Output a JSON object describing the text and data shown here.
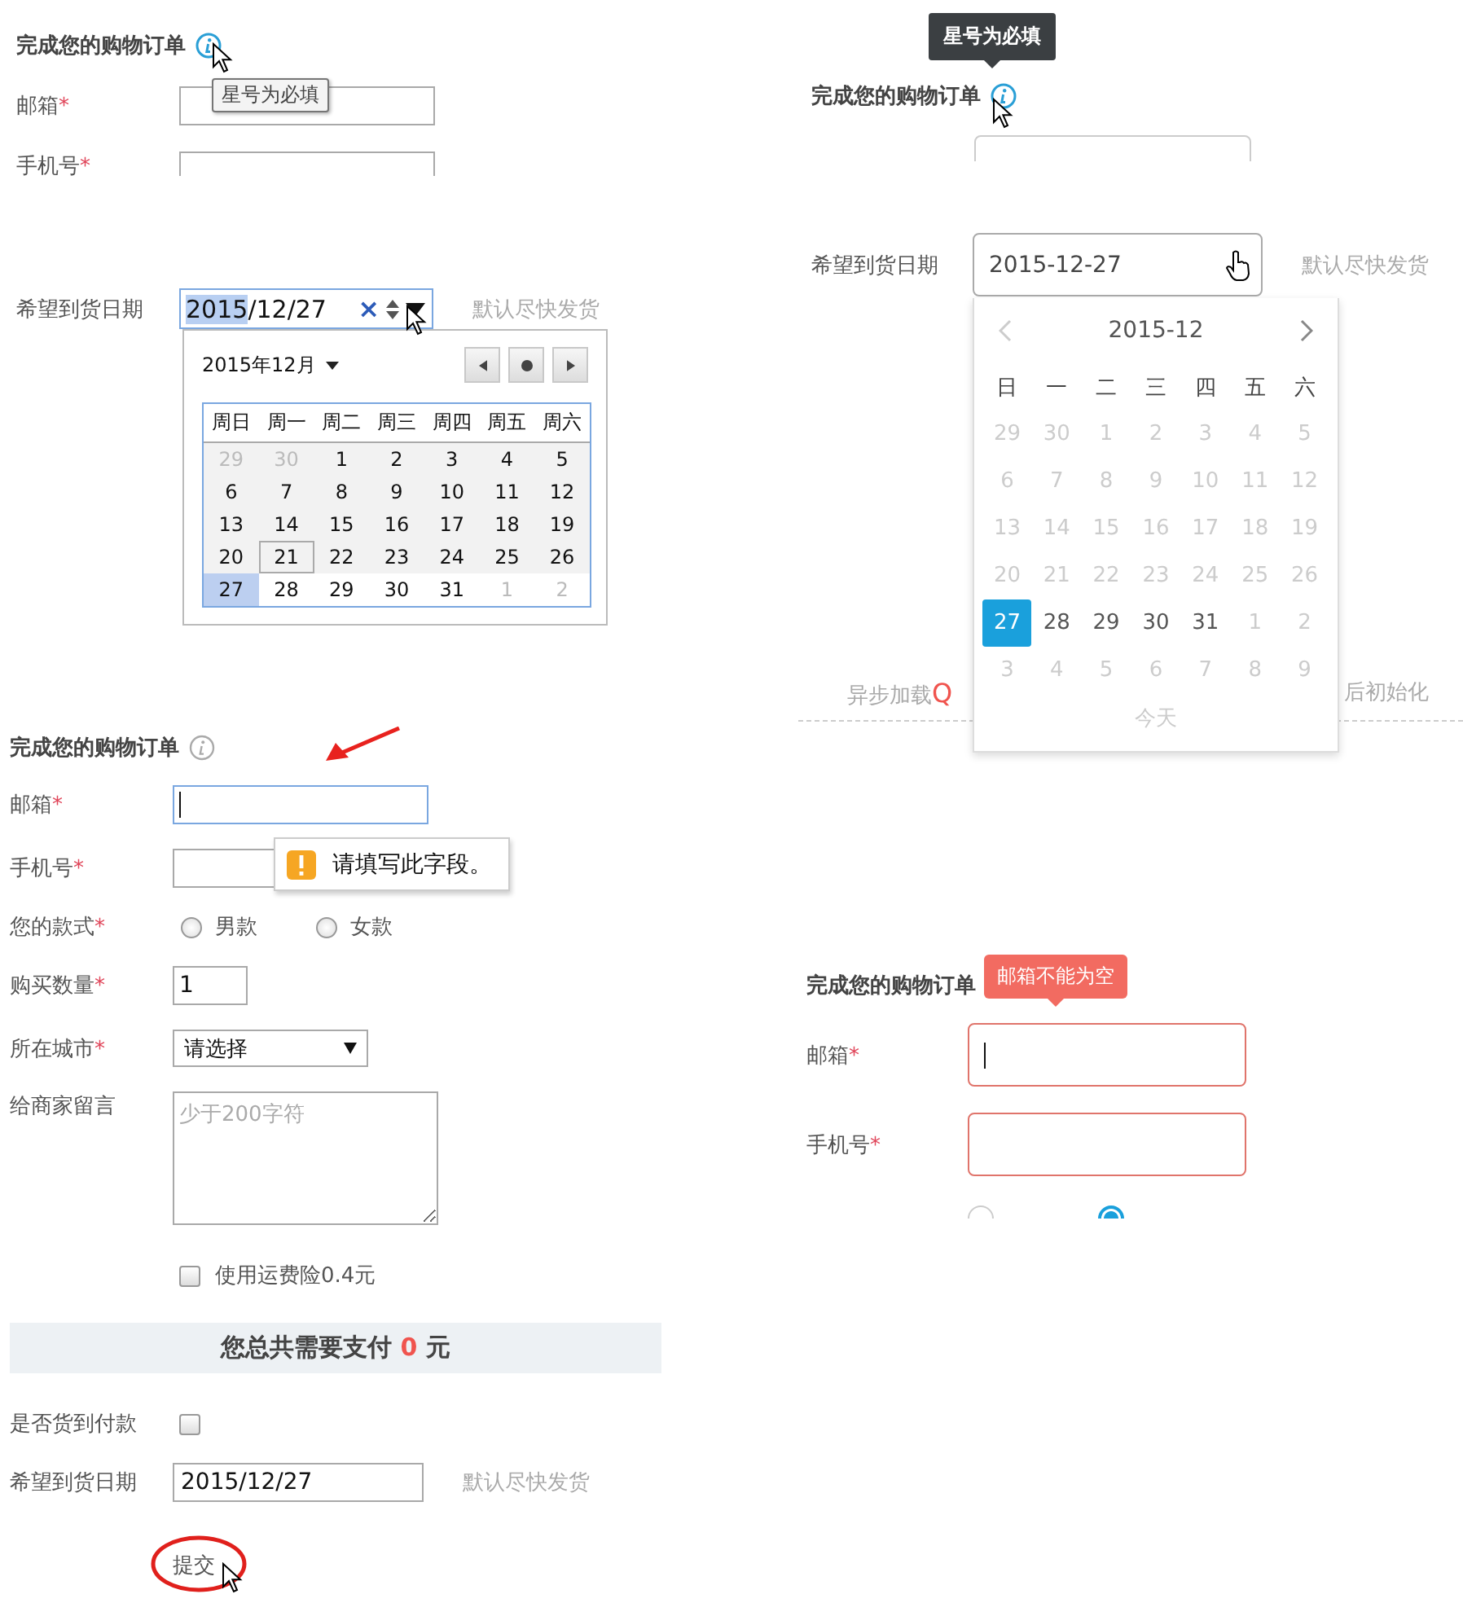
{
  "native_form": {
    "title": "完成您的购物订单",
    "tooltip": "星号为必填",
    "fields": [
      {
        "label": "邮箱",
        "star": "*"
      },
      {
        "label": "手机号",
        "star": "*"
      }
    ],
    "date": {
      "label": "希望到货日期",
      "value_parts": [
        {
          "text": "2015",
          "selected": true
        },
        {
          "text": "/12/27",
          "selected": false
        }
      ],
      "clear": "×",
      "hint": "默认尽快发货"
    },
    "calendar": {
      "month": "2015年12月",
      "weekdays": [
        "周日",
        "周一",
        "周二",
        "周三",
        "周四",
        "周五",
        "周六"
      ],
      "days": [
        {
          "text": "29",
          "muted": true,
          "selected": false,
          "today": false
        },
        {
          "text": "30",
          "muted": true,
          "selected": false,
          "today": false
        },
        {
          "text": "1",
          "muted": false,
          "selected": false,
          "today": false
        },
        {
          "text": "2",
          "muted": false,
          "selected": false,
          "today": false
        },
        {
          "text": "3",
          "muted": false,
          "selected": false,
          "today": false
        },
        {
          "text": "4",
          "muted": false,
          "selected": false,
          "today": false
        },
        {
          "text": "5",
          "muted": false,
          "selected": false,
          "today": false
        },
        {
          "text": "6",
          "muted": false,
          "selected": false,
          "today": false
        },
        {
          "text": "7",
          "muted": false,
          "selected": false,
          "today": false
        },
        {
          "text": "8",
          "muted": false,
          "selected": false,
          "today": false
        },
        {
          "text": "9",
          "muted": false,
          "selected": false,
          "today": false
        },
        {
          "text": "10",
          "muted": false,
          "selected": false,
          "today": false
        },
        {
          "text": "11",
          "muted": false,
          "selected": false,
          "today": false
        },
        {
          "text": "12",
          "muted": false,
          "selected": false,
          "today": false
        },
        {
          "text": "13",
          "muted": false,
          "selected": false,
          "today": false
        },
        {
          "text": "14",
          "muted": false,
          "selected": false,
          "today": false
        },
        {
          "text": "15",
          "muted": false,
          "selected": false,
          "today": false
        },
        {
          "text": "16",
          "muted": false,
          "selected": false,
          "today": false
        },
        {
          "text": "17",
          "muted": false,
          "selected": false,
          "today": false
        },
        {
          "text": "18",
          "muted": false,
          "selected": false,
          "today": false
        },
        {
          "text": "19",
          "muted": false,
          "selected": false,
          "today": false
        },
        {
          "text": "20",
          "muted": false,
          "selected": false,
          "today": false
        },
        {
          "text": "21",
          "muted": false,
          "selected": false,
          "today": true
        },
        {
          "text": "22",
          "muted": false,
          "selected": false,
          "today": false
        },
        {
          "text": "23",
          "muted": false,
          "selected": false,
          "today": false
        },
        {
          "text": "24",
          "muted": false,
          "selected": false,
          "today": false
        },
        {
          "text": "25",
          "muted": false,
          "selected": false,
          "today": false
        },
        {
          "text": "26",
          "muted": false,
          "selected": false,
          "today": false
        },
        {
          "text": "27",
          "muted": false,
          "selected": true,
          "today": false
        },
        {
          "text": "28",
          "muted": false,
          "selected": false,
          "today": false
        },
        {
          "text": "29",
          "muted": false,
          "selected": false,
          "today": false
        },
        {
          "text": "30",
          "muted": false,
          "selected": false,
          "today": false
        },
        {
          "text": "31",
          "muted": false,
          "selected": false,
          "today": false
        },
        {
          "text": "1",
          "muted": true,
          "selected": false,
          "today": false
        },
        {
          "text": "2",
          "muted": true,
          "selected": false,
          "today": false
        }
      ]
    }
  },
  "styled_form": {
    "tooltip": "星号为必填",
    "title": "完成您的购物订单",
    "date": {
      "label": "希望到货日期",
      "value": "2015-12-27",
      "hint": "默认尽快发货"
    },
    "background_note": {
      "text": "异步加载",
      "accent": "Q",
      "tail": "后初始化"
    },
    "calendar": {
      "month": "2015-12",
      "weekdays": [
        "日",
        "一",
        "二",
        "三",
        "四",
        "五",
        "六"
      ],
      "today_button": "今天",
      "days": [
        {
          "text": "29",
          "muted": true,
          "selected": false
        },
        {
          "text": "30",
          "muted": true,
          "selected": false
        },
        {
          "text": "1",
          "muted": true,
          "selected": false
        },
        {
          "text": "2",
          "muted": true,
          "selected": false
        },
        {
          "text": "3",
          "muted": true,
          "selected": false
        },
        {
          "text": "4",
          "muted": true,
          "selected": false
        },
        {
          "text": "5",
          "muted": true,
          "selected": false
        },
        {
          "text": "6",
          "muted": true,
          "selected": false
        },
        {
          "text": "7",
          "muted": true,
          "selected": false
        },
        {
          "text": "8",
          "muted": true,
          "selected": false
        },
        {
          "text": "9",
          "muted": true,
          "selected": false
        },
        {
          "text": "10",
          "muted": true,
          "selected": false
        },
        {
          "text": "11",
          "muted": true,
          "selected": false
        },
        {
          "text": "12",
          "muted": true,
          "selected": false
        },
        {
          "text": "13",
          "muted": true,
          "selected": false
        },
        {
          "text": "14",
          "muted": true,
          "selected": false
        },
        {
          "text": "15",
          "muted": true,
          "selected": false
        },
        {
          "text": "16",
          "muted": true,
          "selected": false
        },
        {
          "text": "17",
          "muted": true,
          "selected": false
        },
        {
          "text": "18",
          "muted": true,
          "selected": false
        },
        {
          "text": "19",
          "muted": true,
          "selected": false
        },
        {
          "text": "20",
          "muted": true,
          "selected": false
        },
        {
          "text": "21",
          "muted": true,
          "selected": false
        },
        {
          "text": "22",
          "muted": true,
          "selected": false
        },
        {
          "text": "23",
          "muted": true,
          "selected": false
        },
        {
          "text": "24",
          "muted": true,
          "selected": false
        },
        {
          "text": "25",
          "muted": true,
          "selected": false
        },
        {
          "text": "26",
          "muted": true,
          "selected": false
        },
        {
          "text": "27",
          "muted": false,
          "selected": true
        },
        {
          "text": "28",
          "muted": false,
          "selected": false
        },
        {
          "text": "29",
          "muted": false,
          "selected": false
        },
        {
          "text": "30",
          "muted": false,
          "selected": false
        },
        {
          "text": "31",
          "muted": false,
          "selected": false
        },
        {
          "text": "1",
          "muted": true,
          "selected": false
        },
        {
          "text": "2",
          "muted": true,
          "selected": false
        },
        {
          "text": "3",
          "muted": true,
          "selected": false
        },
        {
          "text": "4",
          "muted": true,
          "selected": false
        },
        {
          "text": "5",
          "muted": true,
          "selected": false
        },
        {
          "text": "6",
          "muted": true,
          "selected": false
        },
        {
          "text": "7",
          "muted": true,
          "selected": false
        },
        {
          "text": "8",
          "muted": true,
          "selected": false
        },
        {
          "text": "9",
          "muted": true,
          "selected": false
        }
      ]
    }
  },
  "native_validation": {
    "title": "完成您的购物订单",
    "email": {
      "label": "邮箱",
      "star": "*"
    },
    "message": "请填写此字段。",
    "phone": {
      "label": "手机号",
      "star": "*"
    },
    "gender": {
      "label": "您的款式",
      "star": "*",
      "options": [
        {
          "label": "男款",
          "selected": false
        },
        {
          "label": "女款",
          "selected": false
        }
      ]
    },
    "quantity": {
      "label": "购买数量",
      "star": "*",
      "value": "1"
    },
    "city": {
      "label": "所在城市",
      "star": "*",
      "value": "请选择"
    },
    "note": {
      "label": "给商家留言",
      "placeholder": "少于200字符"
    },
    "insurance": {
      "label": "使用运费险0.4元",
      "checked": false
    },
    "total": {
      "text": "您总共需要支付",
      "amount": "0",
      "unit": "元"
    },
    "cod": {
      "label": "是否货到付款",
      "checked": false
    },
    "date": {
      "label": "希望到货日期",
      "value": "2015/12/27",
      "hint": "默认尽快发货"
    },
    "submit": "提交"
  },
  "styled_validation": {
    "title": "完成您的购物订单",
    "error": "邮箱不能为空",
    "fields": [
      {
        "label": "邮箱",
        "star": "*",
        "error": true
      },
      {
        "label": "手机号",
        "star": "*",
        "error": true
      }
    ],
    "gender": {
      "options": [
        {
          "selected": false
        },
        {
          "selected": true
        }
      ]
    }
  }
}
